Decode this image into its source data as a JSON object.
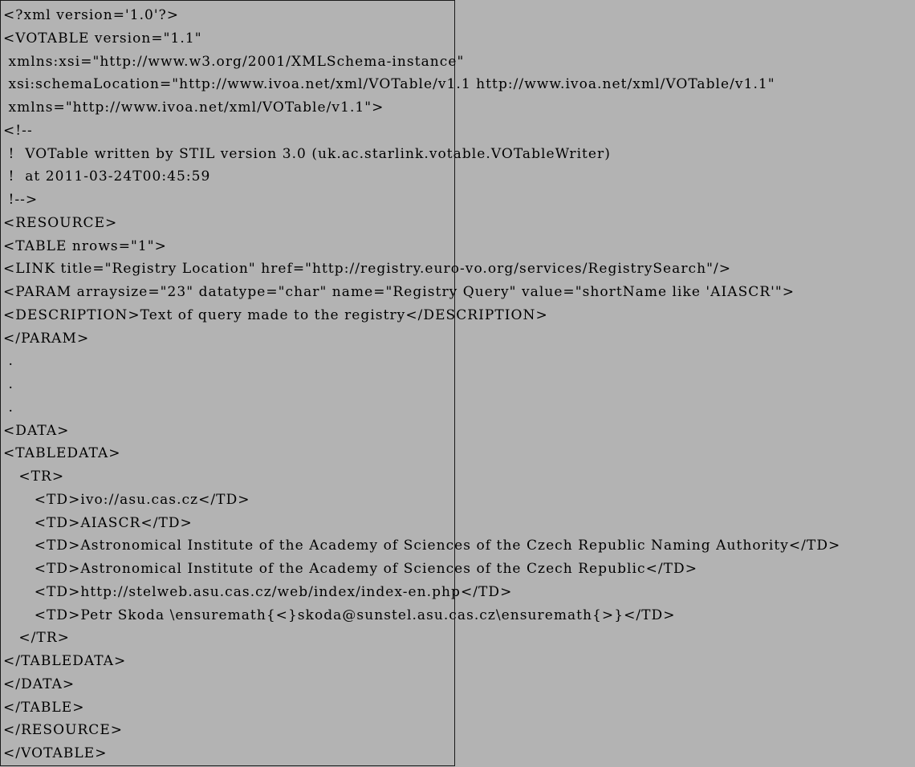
{
  "listing": {
    "lines": [
      {
        "text": "<?xml version='1.0'?>"
      },
      {
        "text": "<VOTABLE version=\"1.1\""
      },
      {
        "text": " xmlns:xsi=\"http://www.w3.org/2001/XMLSchema-instance\""
      },
      {
        "text": " xsi:schemaLocation=\"http://www.ivoa.net/xml/VOTable/v1.1 http://www.ivoa.net/xml/VOTable/v1.1\""
      },
      {
        "text": " xmlns=\"http://www.ivoa.net/xml/VOTable/v1.1\">"
      },
      {
        "text": "<!--"
      },
      {
        "text": " !  VOTable written by STIL version 3.0 (uk.ac.starlink.votable.VOTableWriter)"
      },
      {
        "text": " !  at 2011-03-24T00:45:59"
      },
      {
        "text": " !-->"
      },
      {
        "text": "<RESOURCE>"
      },
      {
        "text": "<TABLE nrows=\"1\">"
      },
      {
        "text": "<LINK title=\"Registry Location\" href=\"http://registry.euro-vo.org/services/RegistrySearch\"/>"
      },
      {
        "text": "<PARAM arraysize=\"23\" datatype=\"char\" name=\"Registry Query\" value=\"shortName like 'AIASCR'\">"
      },
      {
        "text": "<DESCRIPTION>Text of query made to the registry</DESCRIPTION>"
      },
      {
        "text": "</PARAM>"
      },
      {
        "text": " ."
      },
      {
        "text": " ."
      },
      {
        "text": " ."
      },
      {
        "text": "<DATA>"
      },
      {
        "text": "<TABLEDATA>"
      },
      {
        "text": "   <TR>"
      },
      {
        "text": "      <TD>ivo://asu.cas.cz</TD>"
      },
      {
        "text": "      <TD>AIASCR</TD>"
      },
      {
        "text": "      <TD>Astronomical Institute of the Academy of Sciences of the Czech Republic Naming Authority</TD>"
      },
      {
        "text": "      <TD>Astronomical Institute of the Academy of Sciences of the Czech Republic</TD>"
      },
      {
        "text": "      <TD>http://stelweb.asu.cas.cz/web/index/index-en.php</TD>"
      },
      {
        "text": "      <TD>Petr Skoda \\ensuremath{<}skoda@sunstel.asu.cas.cz\\ensuremath{>}</TD>"
      },
      {
        "text": "   </TR>"
      },
      {
        "text": "</TABLEDATA>"
      },
      {
        "text": "</DATA>"
      },
      {
        "text": "</TABLE>"
      },
      {
        "text": "</RESOURCE>"
      },
      {
        "text": "</VOTABLE>"
      }
    ]
  }
}
